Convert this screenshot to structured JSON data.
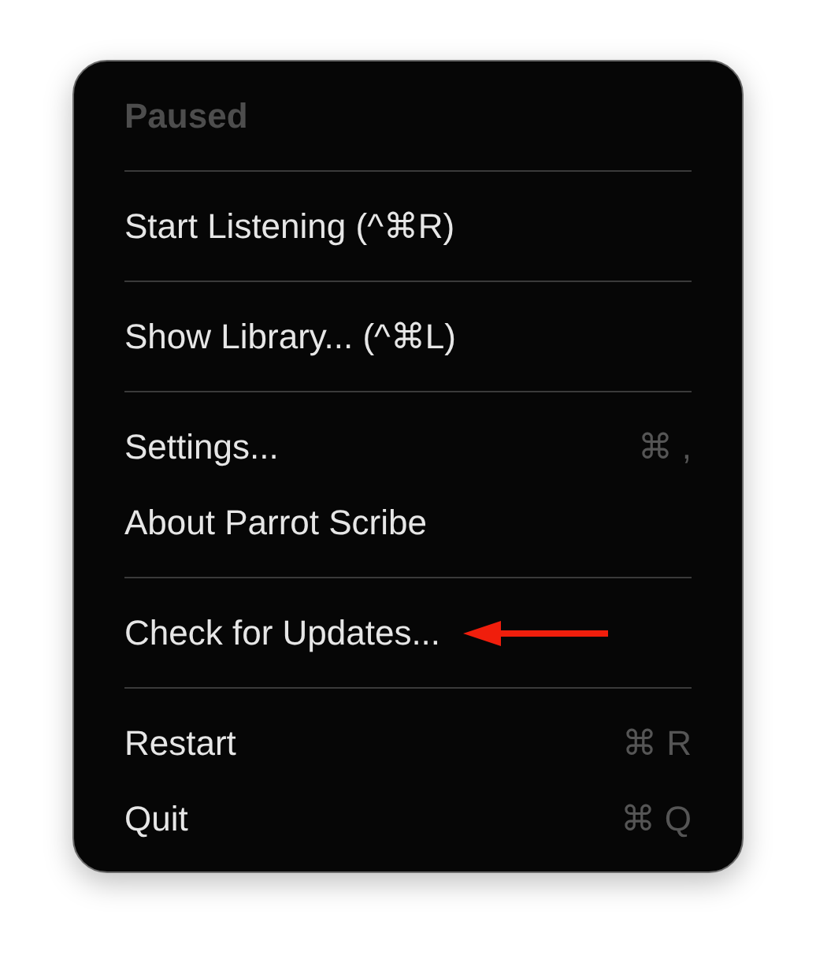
{
  "menu": {
    "header": {
      "label": "Paused",
      "disabled": true
    },
    "sections": [
      [
        {
          "label": "Start Listening (^⌘R)",
          "arrow": false
        }
      ],
      [
        {
          "label": "Show Library... (^⌘L)",
          "arrow": false
        }
      ],
      [
        {
          "label": "Settings...",
          "shortcut": "⌘ ,",
          "arrow": false
        },
        {
          "label": "About Parrot Scribe",
          "arrow": false
        }
      ],
      [
        {
          "label": "Check for Updates...",
          "arrow": true
        }
      ],
      [
        {
          "label": "Restart",
          "shortcut": "⌘ R",
          "arrow": false
        },
        {
          "label": "Quit",
          "shortcut": "⌘ Q",
          "arrow": false
        }
      ]
    ]
  }
}
